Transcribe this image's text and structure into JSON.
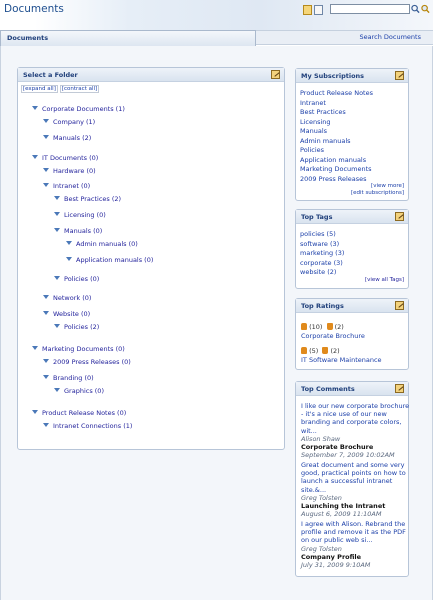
{
  "header": {
    "title": "Documents"
  },
  "tabs": {
    "documents": "Documents",
    "search": "Search Documents"
  },
  "folders": {
    "title": "Select a Folder",
    "expand_all": "[expand all]",
    "contract_all": "[contract all]",
    "items": [
      "Corporate Documents (1)",
      "Company (1)",
      "Manuals (2)",
      "IT Documents (0)",
      "Hardware (0)",
      "Intranet (0)",
      "Best Practices (2)",
      "Licensing (0)",
      "Manuals (0)",
      "Admin manuals (0)",
      "Application manuals (0)",
      "Policies (0)",
      "Network (0)",
      "Website (0)",
      "Policies (2)",
      "Marketing Documents (0)",
      "2009 Press Releases (0)",
      "Branding (0)",
      "Graphics (0)",
      "Product Release Notes (0)",
      "Intranet Connections (1)"
    ]
  },
  "subscriptions": {
    "title": "My Subscriptions",
    "items": [
      "Product Release Notes",
      "Intranet",
      "Best Practices",
      "Licensing",
      "Manuals",
      "Admin manuals",
      "Policies",
      "Application manuals",
      "Marketing Documents",
      "2009 Press Releases"
    ],
    "view_more": "[view more]",
    "edit": "[edit subscriptions]"
  },
  "tags": {
    "title": "Top Tags",
    "items": [
      "policies (5)",
      "software (3)",
      "marketing (3)",
      "corporate (3)",
      "website (2)"
    ],
    "view_all": "[view all Tags]"
  },
  "ratings": {
    "title": "Top Ratings",
    "items": [
      {
        "up": "(10)",
        "down": "(2)",
        "name": "Corporate Brochure"
      },
      {
        "up": "(5)",
        "down": "(2)",
        "name": "IT Software Maintenance"
      }
    ]
  },
  "comments": {
    "title": "Top Comments",
    "items": [
      {
        "text": "I like our new corporate brochure - it's a nice use of our new branding and corporate colors, wit...",
        "author": "Alison Shaw",
        "doc": "Corporate Brochure",
        "date": "September 7, 2009 10:02AM"
      },
      {
        "text": "Great document and some very good, practical points on how to launch a successful intranet site.&...",
        "author": "Greg Tolsten",
        "doc": "Launching the Intranet",
        "date": "August 6, 2009 11:10AM"
      },
      {
        "text": "I agree with Alison. Rebrand the profile and remove it as the PDF on our public web si...",
        "author": "Greg Tolsten",
        "doc": "Company Profile",
        "date": "July 31, 2009 9:10AM"
      }
    ]
  },
  "colors": {
    "link": "#1a3ea8",
    "panel_border": "#b7c5d8",
    "header_text": "#1f4f8f",
    "tree_arrow": "#4a78b8"
  }
}
